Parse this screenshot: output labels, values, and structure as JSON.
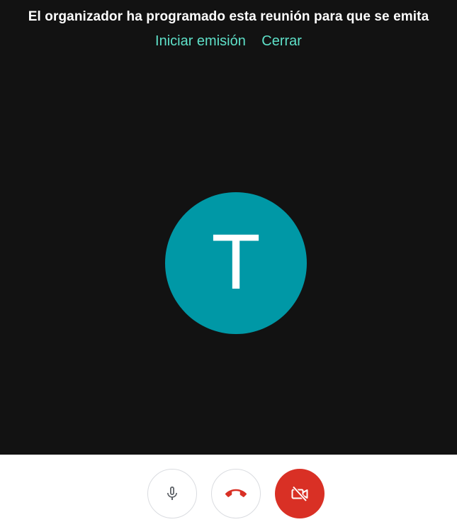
{
  "banner": {
    "message": "El organizador ha programado esta reunión para que se emita",
    "start_label": "Iniciar emisión",
    "close_label": "Cerrar"
  },
  "participant": {
    "initial": "T",
    "avatar_color": "#0098a6"
  },
  "controls": {
    "microphone": {
      "icon": "microphone-icon",
      "state": "on"
    },
    "hangup": {
      "icon": "hang-up-icon",
      "color": "#d93025"
    },
    "camera": {
      "icon": "video-off-icon",
      "state": "off",
      "color": "#d93025"
    }
  },
  "colors": {
    "stage_background": "#121212",
    "accent": "#5ee0c8"
  }
}
